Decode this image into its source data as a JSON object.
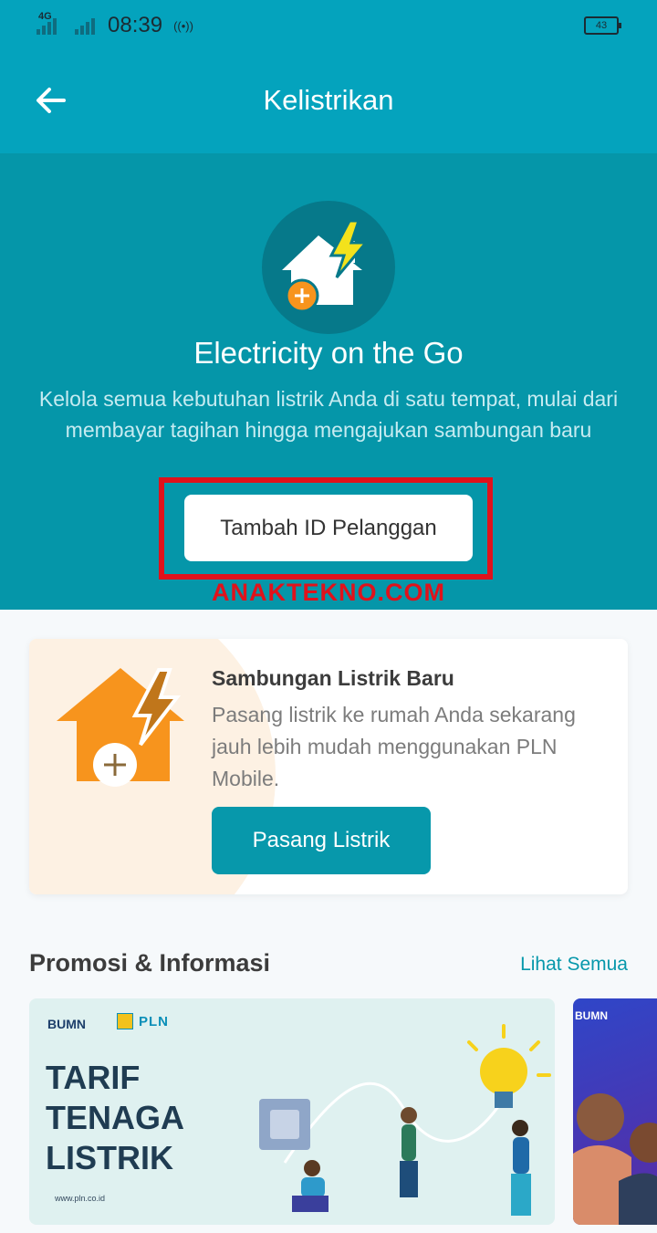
{
  "status_bar": {
    "network_label": "4G",
    "time": "08:39",
    "hotspot": "((•))",
    "battery": "43"
  },
  "app_bar": {
    "title": "Kelistrikan"
  },
  "hero": {
    "title": "Electricity on the Go",
    "description": "Kelola semua kebutuhan listrik Anda di satu tempat, mulai dari membayar tagihan hingga mengajukan sambungan baru",
    "add_button": "Tambah ID Pelanggan",
    "watermark": "ANAKTEKNO.COM"
  },
  "new_connection_card": {
    "title": "Sambungan Listrik Baru",
    "description": "Pasang listrik ke rumah Anda sekarang jauh lebih mudah menggunakan PLN Mobile.",
    "button": "Pasang Listrik"
  },
  "promo_section": {
    "title": "Promosi & Informasi",
    "see_all": "Lihat Semua",
    "banners": [
      {
        "bumn_logo": "BUMN",
        "pln_logo": "PLN",
        "lines": [
          "TARIF",
          "TENAGA",
          "LISTRIK"
        ],
        "url": "www.pln.co.id"
      },
      {
        "bumn_logo": "BUMN"
      }
    ]
  },
  "colors": {
    "app_bar": "#04a3bd",
    "hero": "#0596a9",
    "accent": "#0798ab",
    "highlight": "#e0121b",
    "orange": "#f7941d"
  }
}
